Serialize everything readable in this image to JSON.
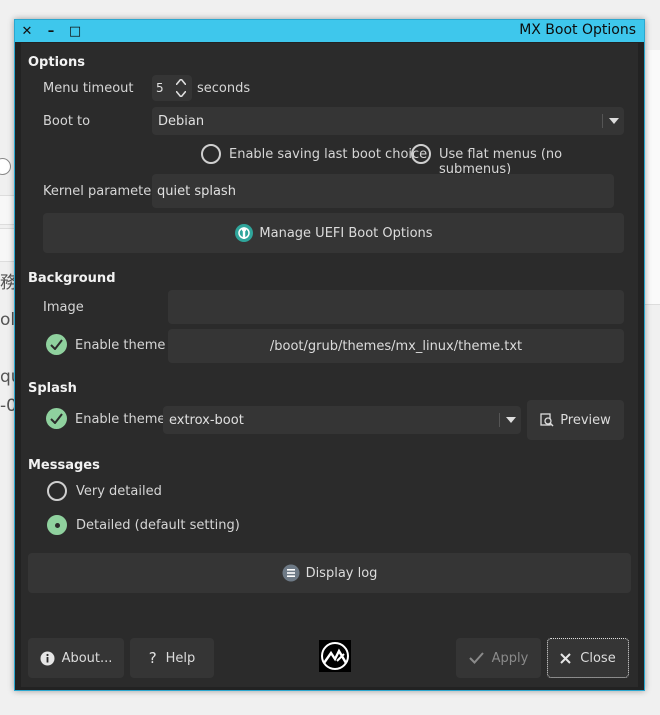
{
  "background_app": {
    "chars": [
      "務",
      "ole",
      "qu",
      "-0"
    ]
  },
  "window": {
    "title": "MX Boot Options",
    "controls": {
      "close": "✕",
      "minimize": "–",
      "maximize": "□"
    }
  },
  "options": {
    "heading": "Options",
    "menu_timeout_label": "Menu timeout",
    "menu_timeout_value": "5",
    "menu_timeout_unit": "seconds",
    "boot_to_label": "Boot to",
    "boot_to_value": "Debian",
    "enable_saving_label": "Enable saving last boot choice",
    "flat_menus_label": "Use flat menus (no submenus)",
    "kernel_params_label": "Kernel parameters",
    "kernel_params_value": "quiet splash",
    "manage_uefi_label": "Manage UEFI Boot Options"
  },
  "background": {
    "heading": "Background",
    "image_label": "Image",
    "image_value": "",
    "enable_theme_label": "Enable theme",
    "theme_path": "/boot/grub/themes/mx_linux/theme.txt"
  },
  "splash": {
    "heading": "Splash",
    "enable_theme_label": "Enable theme",
    "theme_value": "extrox-boot",
    "preview_label": "Preview"
  },
  "messages": {
    "heading": "Messages",
    "very_detailed_label": "Very detailed",
    "detailed_label": "Detailed (default setting)"
  },
  "display_log_label": "Display log",
  "footer": {
    "about_label": "About...",
    "help_label": "Help",
    "apply_label": "Apply",
    "close_label": "Close"
  },
  "colors": {
    "titlebar": "#3ec7ec",
    "accent_green": "#8fd19e",
    "panel": "#2b2b2b",
    "field": "#353535"
  }
}
